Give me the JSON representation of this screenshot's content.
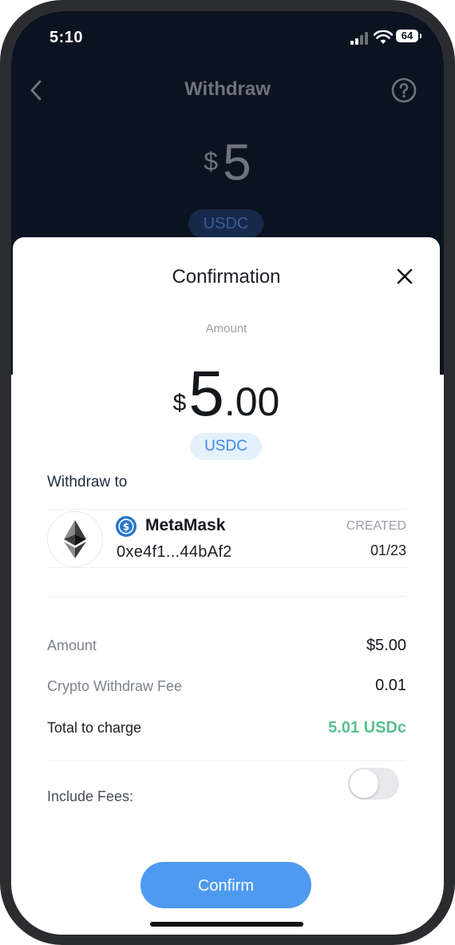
{
  "status_bar": {
    "time": "5:10",
    "battery": "64"
  },
  "header": {
    "title": "Withdraw"
  },
  "background_amount": {
    "currency_symbol": "$",
    "value": "5",
    "token": "USDC"
  },
  "sheet": {
    "title": "Confirmation",
    "amount_label": "Amount",
    "amount": {
      "currency_symbol": "$",
      "integer": "5",
      "decimal": ".00"
    },
    "token": "USDC",
    "withdraw_to_label": "Withdraw to",
    "wallet": {
      "name": "MetaMask",
      "address": "0xe4f1...44bAf2",
      "created_label": "CREATED",
      "created_date": "01/23"
    },
    "summary": [
      {
        "label": "Amount",
        "value": "$5.00"
      },
      {
        "label": "Crypto Withdraw Fee",
        "value": "0.01"
      },
      {
        "label": "Total to charge",
        "value": "5.01 USDc"
      }
    ],
    "include_fees": {
      "label": "Include Fees:",
      "enabled": false
    },
    "confirm_label": "Confirm"
  },
  "colors": {
    "accent": "#4d9af0",
    "total_green": "#59c08c",
    "chip_bg": "#e4f0fc",
    "dark_bg": "#0b1321"
  }
}
